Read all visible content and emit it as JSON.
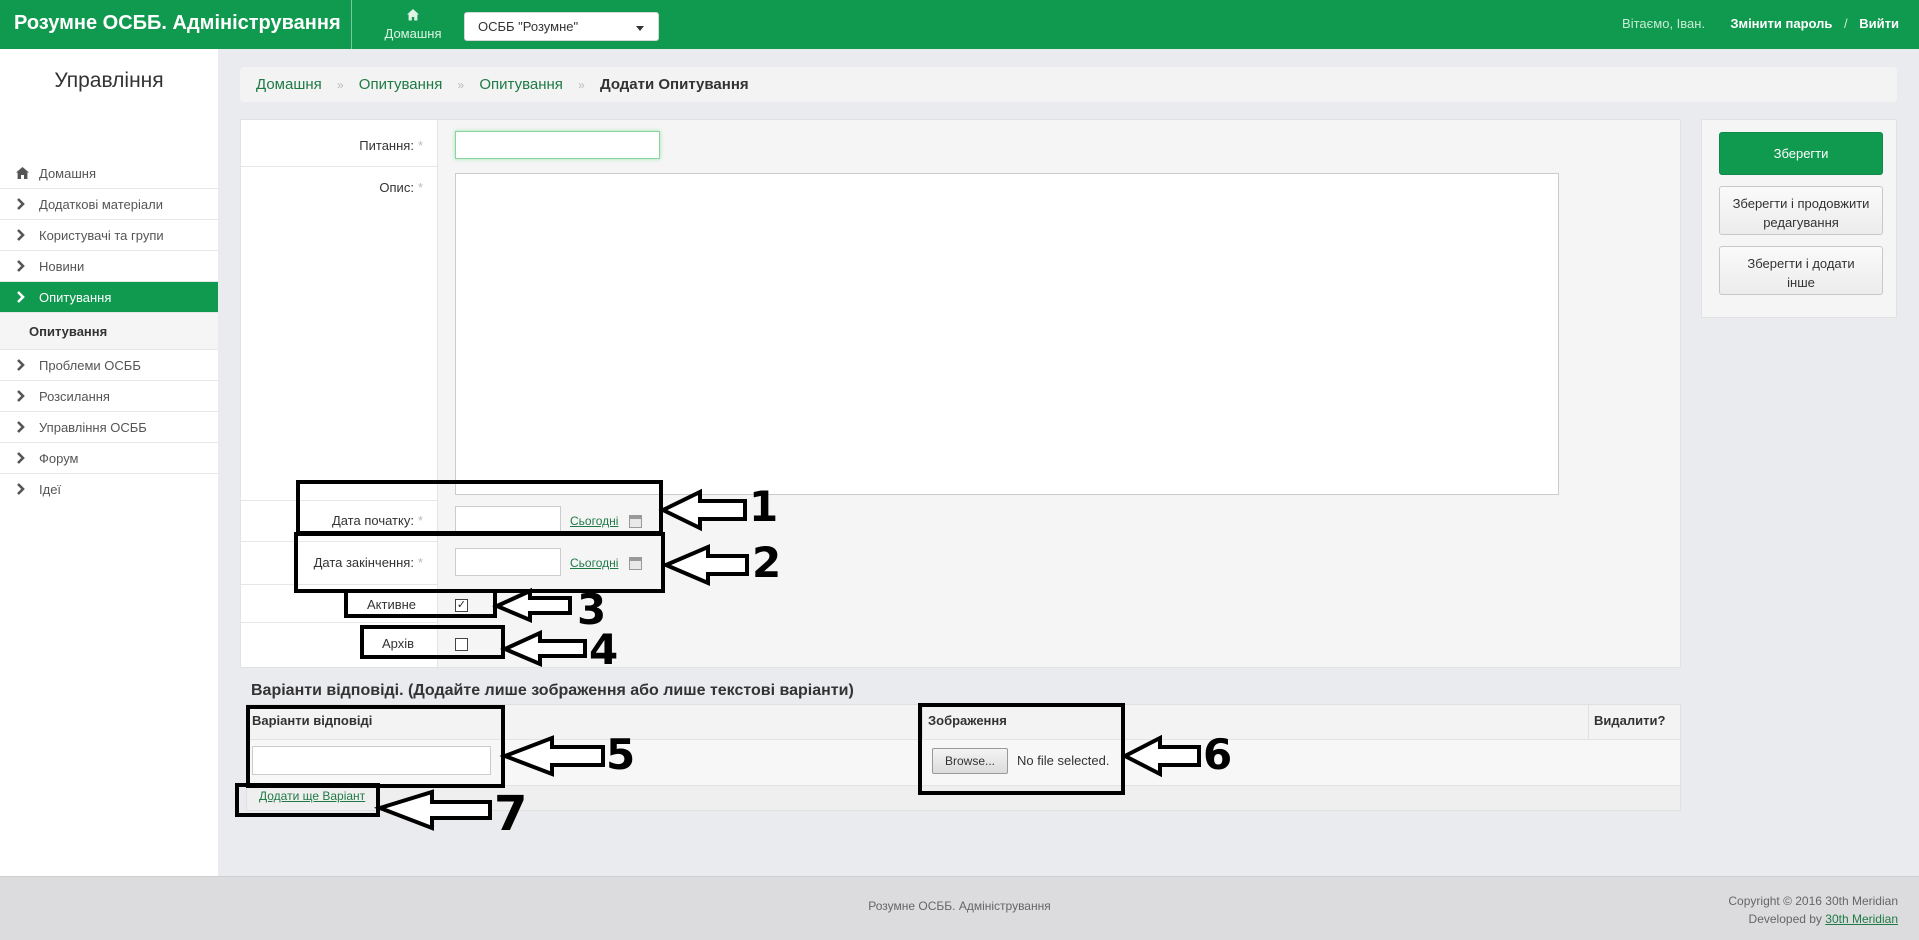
{
  "header": {
    "brand": "Розумне ОСББ. Адміністрування",
    "home_label": "Домашня",
    "org_selected": "ОСББ \"Розумне\"",
    "greeting": "Вітаємо, Іван.",
    "change_password": "Змінити пароль",
    "separator": "/",
    "logout": "Вийти"
  },
  "sidebar": {
    "title": "Управління",
    "items": [
      {
        "label": "Домашня",
        "icon": "home-icon"
      },
      {
        "label": "Додаткові матеріали",
        "icon": "chevron-right-icon"
      },
      {
        "label": "Користувачі та групи",
        "icon": "chevron-right-icon"
      },
      {
        "label": "Новини",
        "icon": "chevron-right-icon"
      },
      {
        "label": "Опитування",
        "icon": "chevron-right-icon",
        "active": true
      },
      {
        "label": "Опитування",
        "sub": true
      },
      {
        "label": "Проблеми ОСББ",
        "icon": "chevron-right-icon"
      },
      {
        "label": "Розсилання",
        "icon": "chevron-right-icon"
      },
      {
        "label": "Управління ОСББ",
        "icon": "chevron-right-icon"
      },
      {
        "label": "Форум",
        "icon": "chevron-right-icon"
      },
      {
        "label": "Ідеї",
        "icon": "chevron-right-icon"
      }
    ]
  },
  "breadcrumb": {
    "items": [
      "Домашня",
      "Опитування",
      "Опитування"
    ],
    "divider": "»",
    "current": "Додати Опитування"
  },
  "form": {
    "question_label": "Питання:",
    "question_value": "",
    "description_label": "Опис:",
    "description_value": "",
    "required_mark": "*",
    "start_date_label": "Дата початку:",
    "start_date_value": "",
    "end_date_label": "Дата закінчення:",
    "end_date_value": "",
    "today_label": "Сьогодні",
    "active_label": "Активне",
    "active_checked": true,
    "archive_label": "Архів",
    "archive_checked": false
  },
  "actions": {
    "save": "Зберегти",
    "save_continue_1": "Зберегти і продовжити",
    "save_continue_2": "редагування",
    "save_add_1": "Зберегти і додати",
    "save_add_2": "інше"
  },
  "variants": {
    "title": "Варіанти відповіді. (Додайте лише зображення або лише текстові варіанти)",
    "col_answer": "Варіанти відповіді",
    "col_image": "Зображення",
    "col_delete": "Видалити?",
    "answer_value": "",
    "browse": "Browse...",
    "no_file": "No file selected.",
    "add_variant": "Додати ще Варіант"
  },
  "footer": {
    "center": "Розумне ОСББ. Адміністрування",
    "copyright": "Copyright © 2016 30th Meridian",
    "developed_by": "Developed by",
    "developer": "30th Meridian"
  },
  "annotations": {
    "labels": [
      "1",
      "2",
      "3",
      "4",
      "5",
      "6",
      "7"
    ],
    "color": "#000000"
  },
  "colors": {
    "brand_green": "#0f9a4f",
    "link_green": "#1f7a45"
  }
}
